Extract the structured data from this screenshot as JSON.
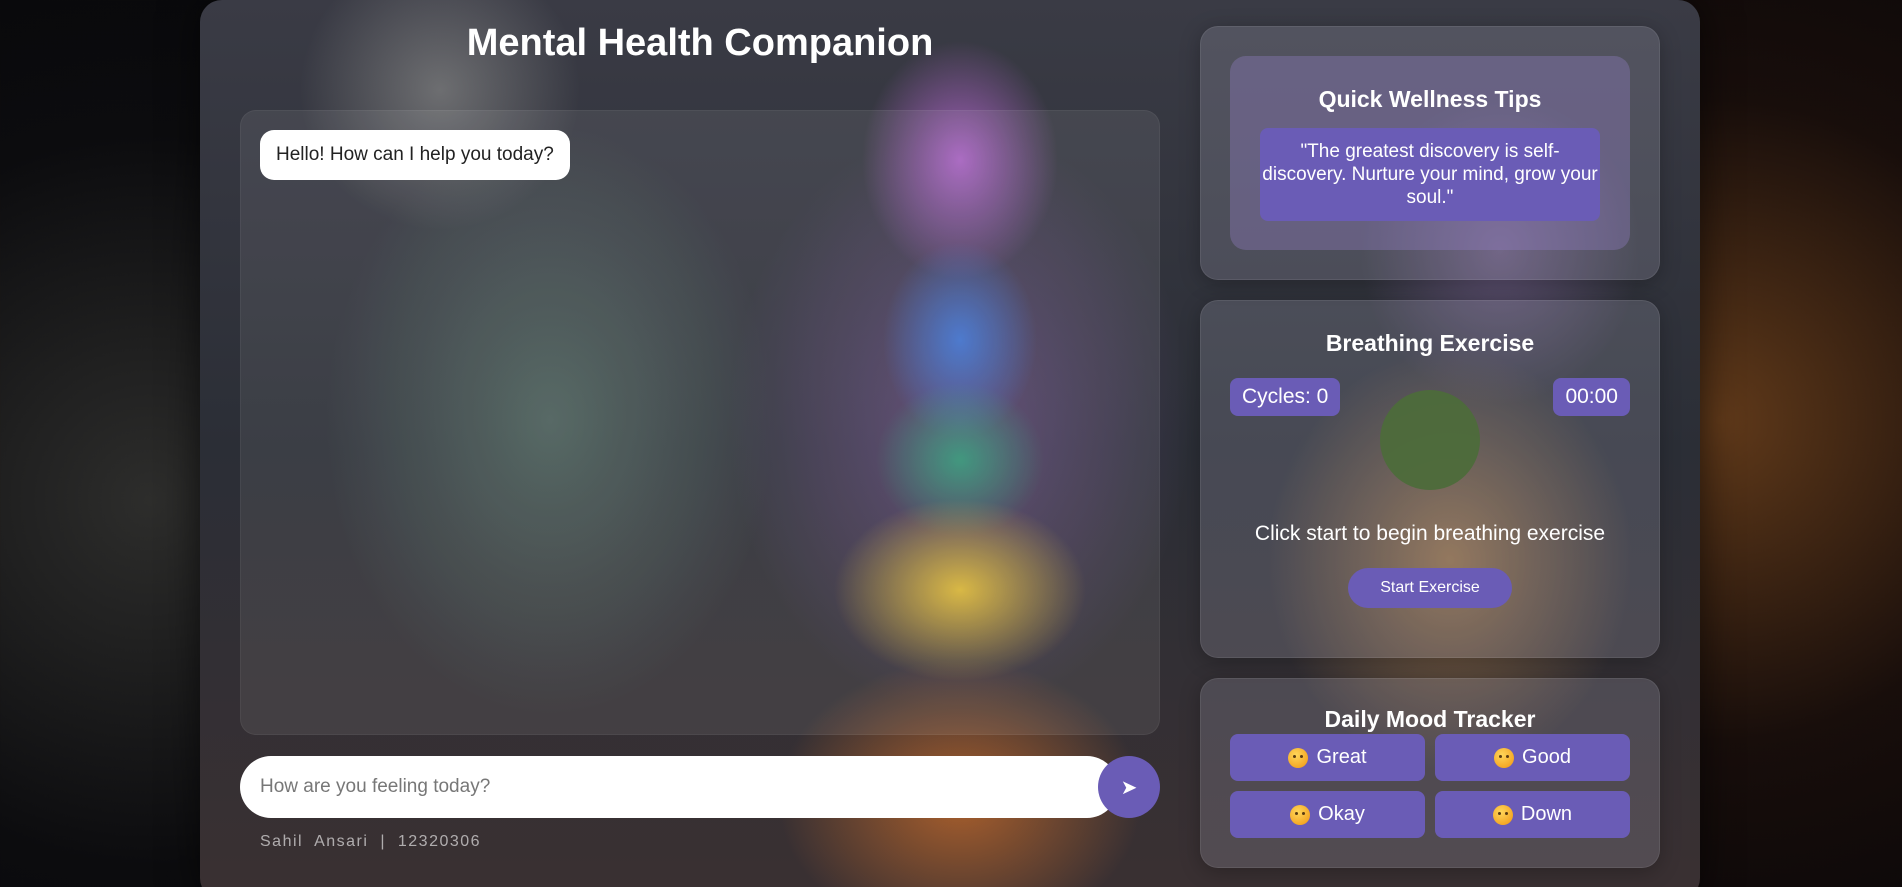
{
  "app": {
    "title": "Mental Health Companion"
  },
  "chat": {
    "messages": [
      {
        "sender": "bot",
        "text": "Hello! How can I help you today?"
      }
    ],
    "input_placeholder": "How are you feeling today?",
    "input_value": "",
    "send_icon": "➤"
  },
  "footer": {
    "credit": "Sahil  Ansari  |  12320306"
  },
  "tips": {
    "title": "Quick Wellness Tips",
    "quote": "\"The greatest discovery is self-discovery. Nurture your mind, grow your soul.\""
  },
  "breathing": {
    "title": "Breathing Exercise",
    "cycles_label": "Cycles: 0",
    "timer": "00:00",
    "instruction": "Click start to begin breathing exercise",
    "start_label": "Start Exercise"
  },
  "mood": {
    "title": "Daily Mood Tracker",
    "options": [
      {
        "label": "Great",
        "icon": "smiling-face-icon"
      },
      {
        "label": "Good",
        "icon": "flushed-face-icon"
      },
      {
        "label": "Okay",
        "icon": "neutral-face-icon"
      },
      {
        "label": "Down",
        "icon": "pensive-face-icon"
      }
    ]
  },
  "colors": {
    "accent": "#6a5cb6",
    "breath_circle": "#4d6b3b",
    "text": "#ffffff"
  }
}
